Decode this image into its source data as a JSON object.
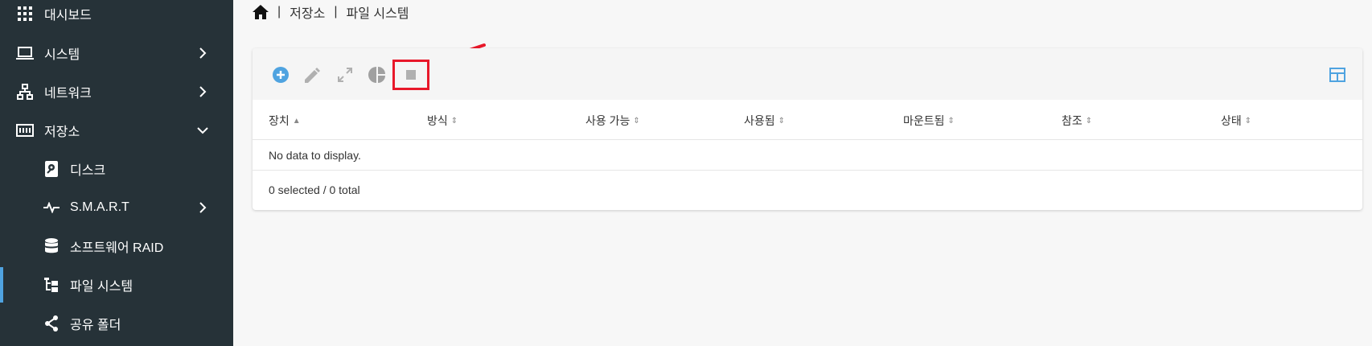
{
  "sidebar": {
    "items": [
      {
        "label": "대시보드",
        "icon": "grid-icon"
      },
      {
        "label": "시스템",
        "icon": "laptop-icon"
      },
      {
        "label": "네트워크",
        "icon": "network-icon"
      },
      {
        "label": "저장소",
        "icon": "storage-icon"
      },
      {
        "label": "디스크",
        "icon": "disk-icon"
      },
      {
        "label": "S.M.A.R.T",
        "icon": "pulse-icon"
      },
      {
        "label": "소프트웨어 RAID",
        "icon": "database-icon"
      },
      {
        "label": "파일 시스템",
        "icon": "file-tree-icon"
      },
      {
        "label": "공유 폴더",
        "icon": "share-icon"
      }
    ]
  },
  "breadcrumb": {
    "items": [
      "저장소",
      "파일 시스템"
    ]
  },
  "table": {
    "columns": [
      "장치",
      "방식",
      "사용 가능",
      "사용됨",
      "마운트됨",
      "참조",
      "상태"
    ],
    "empty_message": "No data to display.",
    "footer": "0 selected / 0 total"
  },
  "colors": {
    "sidebar_bg": "#263238",
    "accent": "#4fa3e0",
    "highlight": "#e8182a"
  }
}
